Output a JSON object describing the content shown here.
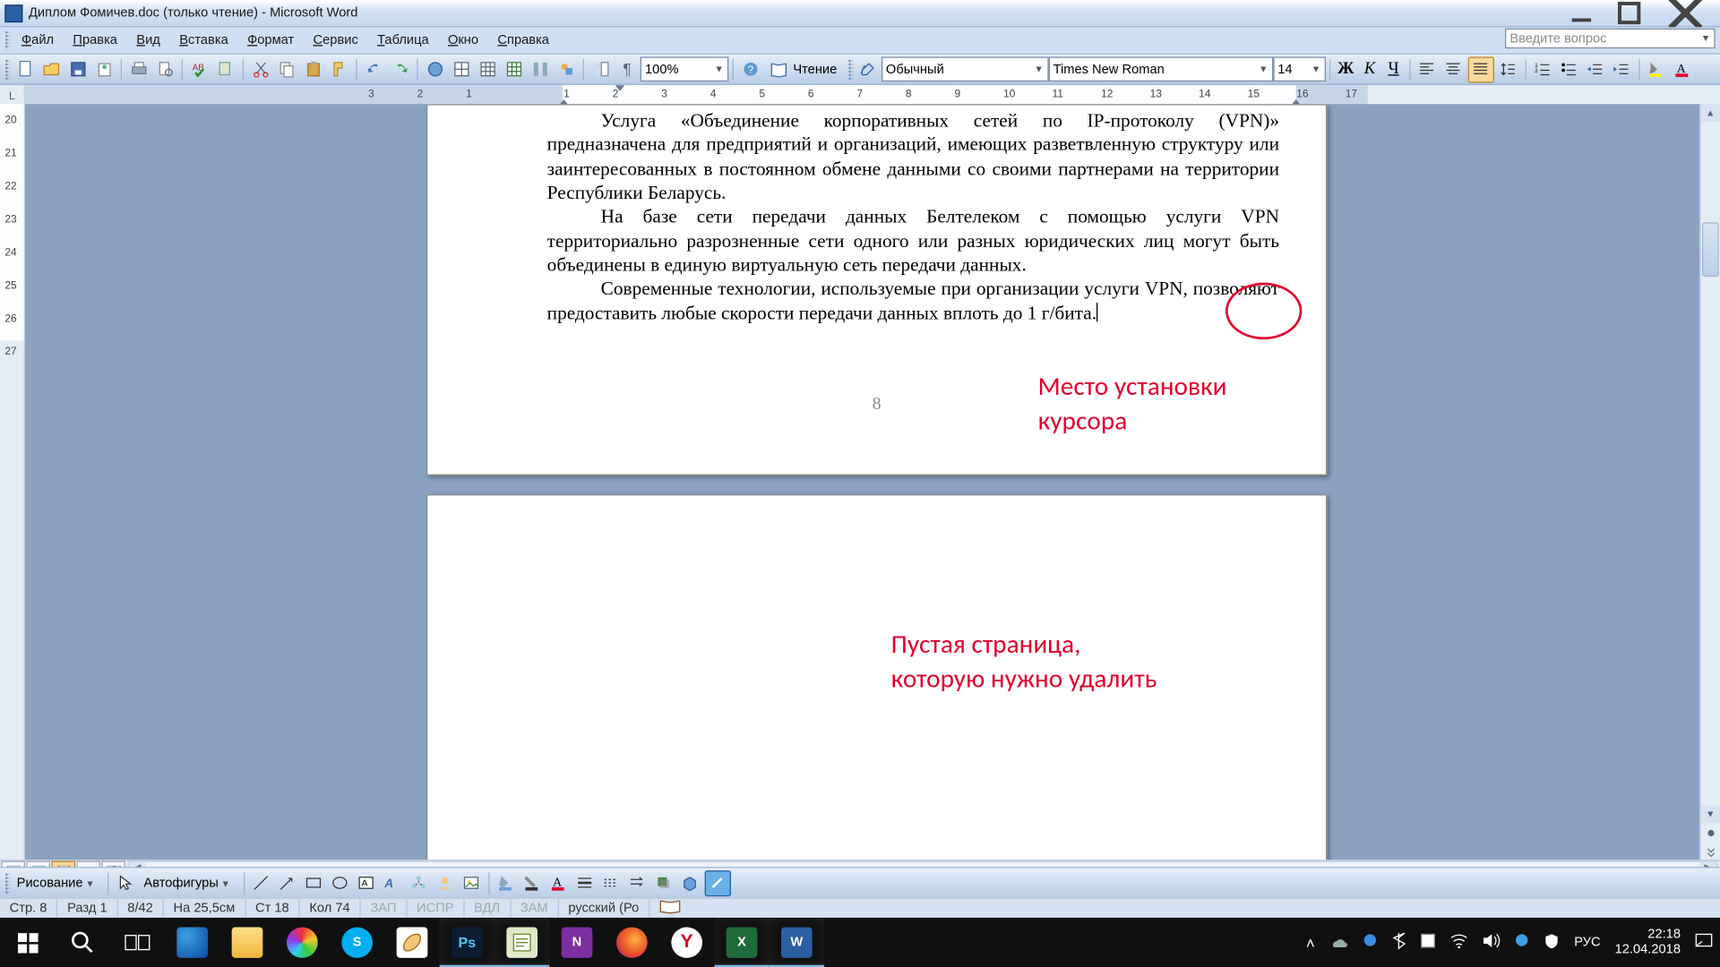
{
  "window": {
    "title": "Диплом Фомичев.doc (только чтение) - Microsoft Word"
  },
  "menus": {
    "file": "Файл",
    "edit": "Правка",
    "view": "Вид",
    "insert": "Вставка",
    "format": "Формат",
    "tools": "Сервис",
    "table": "Таблица",
    "window": "Окно",
    "help": "Справка"
  },
  "ask": {
    "placeholder": "Введите вопрос"
  },
  "toolbar": {
    "zoom": "100%",
    "read_label": "Чтение",
    "style": "Обычный",
    "font": "Times New Roman",
    "size": "14"
  },
  "ruler": {
    "corner": "L",
    "numbers": [
      "3",
      "2",
      "1",
      "1",
      "2",
      "3",
      "4",
      "5",
      "6",
      "7",
      "8",
      "9",
      "10",
      "11",
      "12",
      "13",
      "14",
      "15",
      "16",
      "17"
    ]
  },
  "vruler_numbers": [
    "20",
    "21",
    "22",
    "23",
    "24",
    "25",
    "26",
    "27"
  ],
  "document": {
    "p1": "Услуга «Объединение корпоративных сетей по IP-протоколу (VPN)» предназначена для  предприятий и организаций, имеющих разветвленную структуру или заинтересованных в постоянном обмене данными со своими партнерами на территории Республики Беларусь.",
    "p2": "На базе сети передачи данных Белтелеком  с помощью услуги VPN территориально разрозненные сети одного или разных юридических лиц могут быть объединены в единую виртуальную сеть передачи данных.",
    "p3": "Современные технологии, используемые при организации услуги VPN, позволяют предоставить любые скорости передачи данных вплоть до 1 г/бита.",
    "page_number": "8"
  },
  "annotations": {
    "cursor_label": "Место установки курсора",
    "empty_page_label": "Пустая страница,\nкоторую нужно удалить"
  },
  "drawbar": {
    "drawing": "Рисование",
    "autoshapes": "Автофигуры"
  },
  "status": {
    "page": "Стр. 8",
    "section": "Разд 1",
    "pages": "8/42",
    "at": "На  25,5см",
    "line": "Ст  18",
    "col": "Кол 74",
    "rec": "ЗАП",
    "trk": "ИСПР",
    "ext": "ВДЛ",
    "ovr": "ЗАМ",
    "lang": "русский (Ро"
  },
  "tray": {
    "lang": "РУС",
    "time": "22:18",
    "date": "12.04.2018"
  }
}
